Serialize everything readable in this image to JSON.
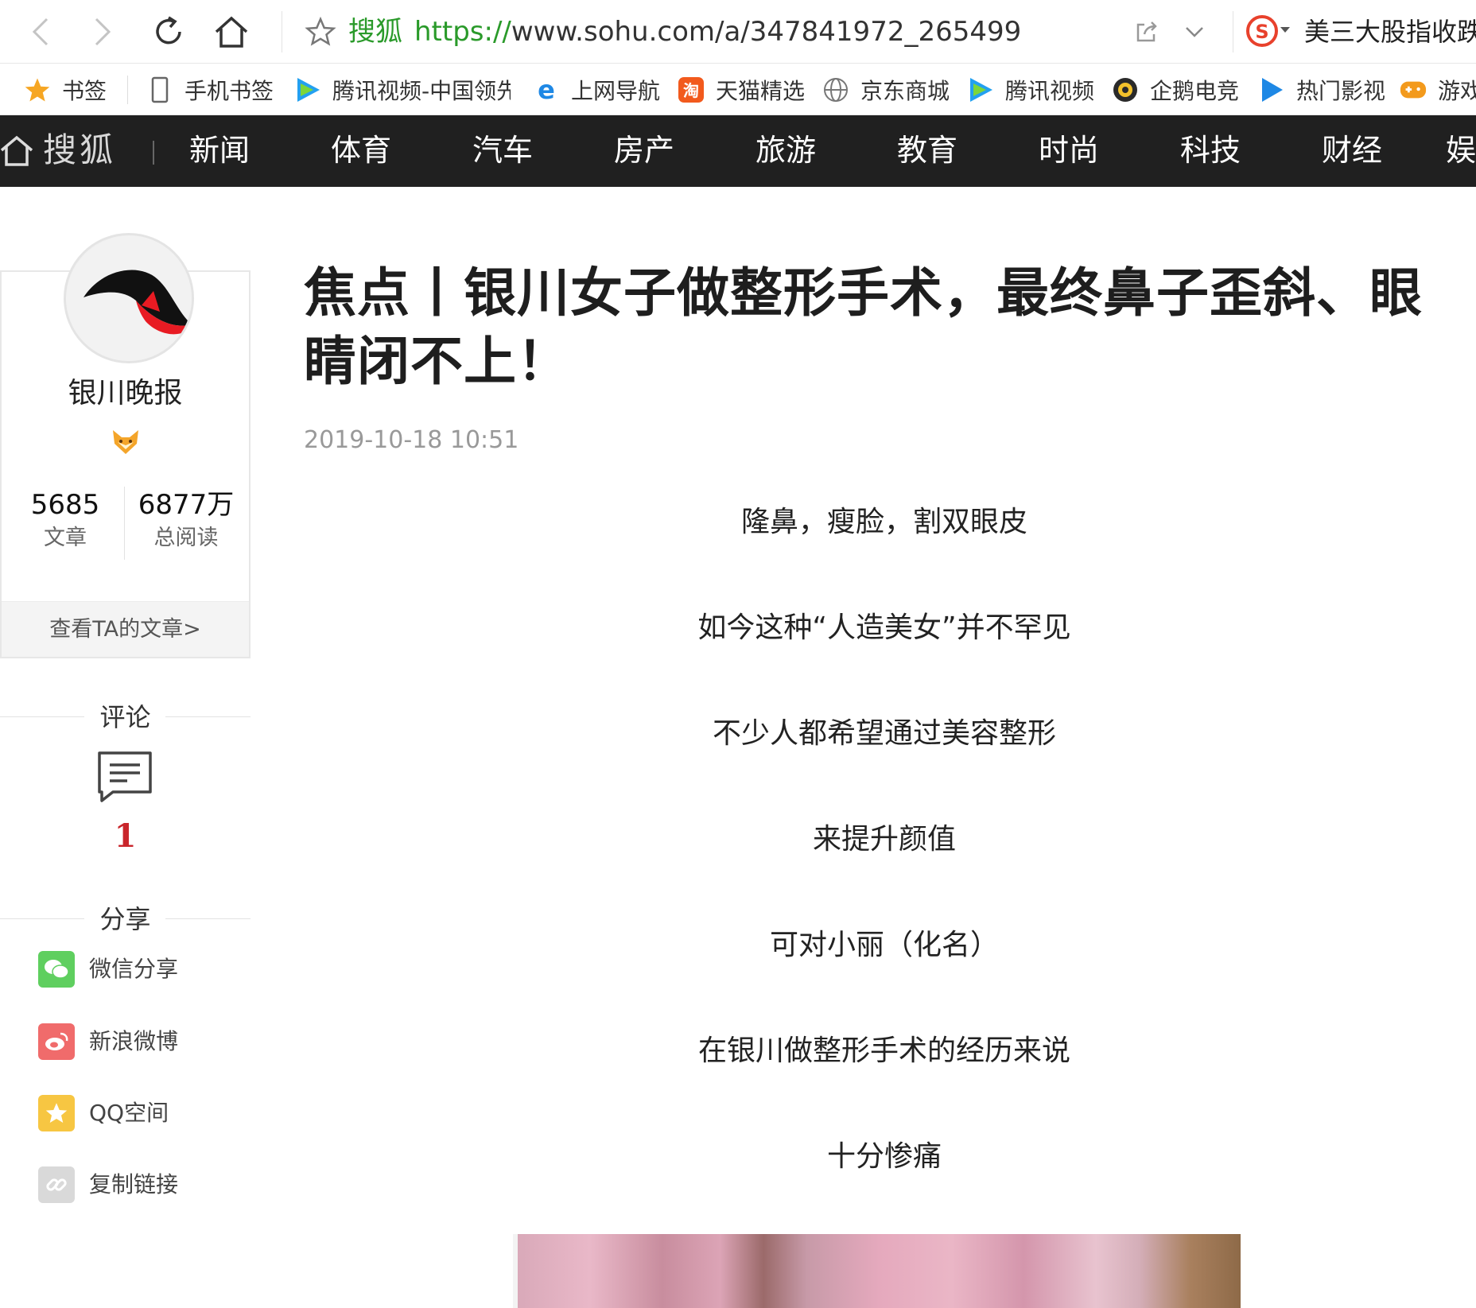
{
  "browser": {
    "site_name": "搜狐",
    "url_proto": "https://",
    "url_rest": "www.sohu.com/a/347841972_265499",
    "search_hot": "美三大股指收跌"
  },
  "bookmarks": [
    {
      "label": "书签",
      "icon": "star-icon"
    },
    {
      "label": "手机书签",
      "icon": "phone-icon"
    },
    {
      "label": "腾讯视频-中国领先",
      "icon": "tencent-video-icon"
    },
    {
      "label": "上网导航",
      "icon": "ie-icon"
    },
    {
      "label": "天猫精选",
      "icon": "taobao-icon"
    },
    {
      "label": "京东商城",
      "icon": "globe-icon"
    },
    {
      "label": "腾讯视频",
      "icon": "tencent-video-icon"
    },
    {
      "label": "企鹅电竞",
      "icon": "penguin-esports-icon"
    },
    {
      "label": "热门影视",
      "icon": "play-icon"
    },
    {
      "label": "游戏",
      "icon": "gamepad-icon"
    }
  ],
  "sitenav": {
    "logo": "搜狐",
    "items": [
      "新闻",
      "体育",
      "汽车",
      "房产",
      "旅游",
      "教育",
      "时尚",
      "科技",
      "财经",
      "娱"
    ]
  },
  "author": {
    "name": "银川晚报",
    "articles_count": "5685",
    "articles_label": "文章",
    "reads_count": "6877万",
    "reads_label": "总阅读",
    "more_link": "查看TA的文章>"
  },
  "sidebar": {
    "comments_title": "评论",
    "comments_count": "1",
    "share_title": "分享",
    "share_items": [
      {
        "label": "微信分享",
        "icon": "wechat-icon",
        "color": "#5fcf5f"
      },
      {
        "label": "新浪微博",
        "icon": "weibo-icon",
        "color": "#f06b6b"
      },
      {
        "label": "QQ空间",
        "icon": "qzone-icon",
        "color": "#f7c642"
      },
      {
        "label": "复制链接",
        "icon": "link-icon",
        "color": "#d9d9d9"
      }
    ]
  },
  "article": {
    "title": "焦点丨银川女子做整形手术，最终鼻子歪斜、眼睛闭不上！",
    "date": "2019-10-18 10:51",
    "paragraphs": [
      "隆鼻，瘦脸，割双眼皮",
      "如今这种“人造美女”并不罕见",
      "不少人都希望通过美容整形",
      "来提升颜值",
      "可对小丽（化名）",
      "在银川做整形手术的经历来说",
      "十分惨痛"
    ]
  }
}
